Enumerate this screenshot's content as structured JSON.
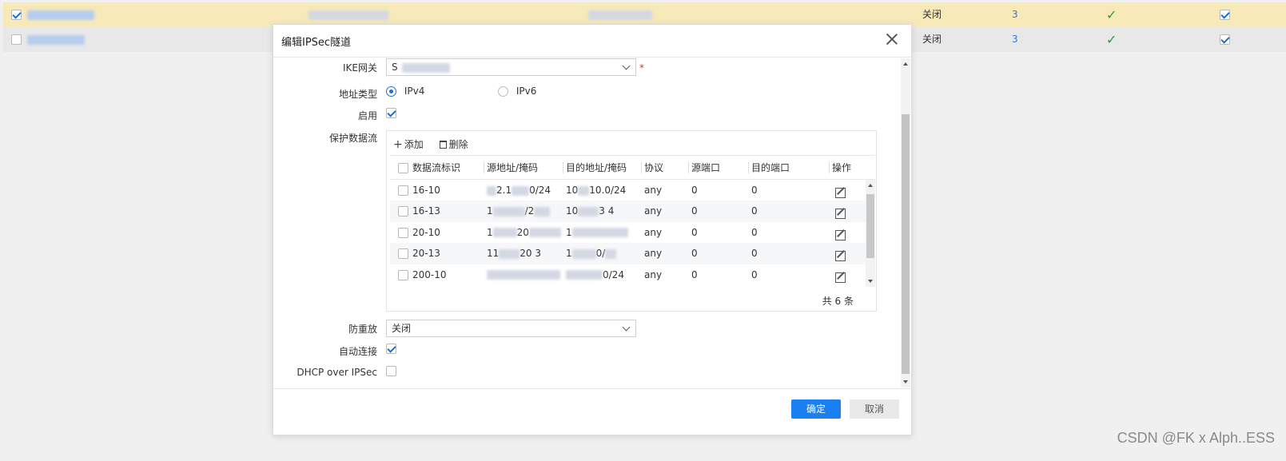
{
  "background_rows": [
    {
      "checked": true,
      "col1": "关闭",
      "col2": "3"
    },
    {
      "checked": false,
      "col1": "关闭",
      "col2": "3"
    }
  ],
  "dialog": {
    "title": "编辑IPSec隧道",
    "fields": {
      "ike_gateway_label": "IKE网关",
      "ike_gateway_value": "S",
      "required_mark": "*",
      "address_type_label": "地址类型",
      "ipv4_label": "IPv4",
      "ipv6_label": "IPv6",
      "enable_label": "启用",
      "protected_flow_label": "保护数据流",
      "anti_replay_label": "防重放",
      "anti_replay_value": "关闭",
      "auto_connect_label": "自动连接",
      "dhcp_label": "DHCP over IPSec"
    },
    "toolbar": {
      "add_label": "添加",
      "delete_label": "删除"
    },
    "grid": {
      "headers": [
        "数据流标识",
        "源地址/掩码",
        "目的地址/掩码",
        "协议",
        "源端口",
        "目的端口",
        "操作"
      ],
      "rows": [
        {
          "id": "16-10",
          "src": "2.1",
          "src_tail": "0/24",
          "dst": "10",
          "dst_tail": "10.0/24",
          "proto": "any",
          "sport": "0",
          "dport": "0"
        },
        {
          "id": "16-13",
          "src": "1",
          "src_tail": "/2",
          "dst": "10",
          "dst_tail": "3  4",
          "proto": "any",
          "sport": "0",
          "dport": "0"
        },
        {
          "id": "20-10",
          "src": "1",
          "src_tail": "20",
          "dst": "1",
          "dst_tail": "",
          "proto": "any",
          "sport": "0",
          "dport": "0"
        },
        {
          "id": "20-13",
          "src": "11",
          "src_tail": "20  3",
          "dst": "1",
          "dst_tail": "0/",
          "proto": "any",
          "sport": "0",
          "dport": "0"
        },
        {
          "id": "200-10",
          "src": "",
          "src_tail": "",
          "dst": "",
          "dst_tail": "0/24",
          "proto": "any",
          "sport": "0",
          "dport": "0"
        }
      ],
      "total": "共 6 条"
    },
    "buttons": {
      "ok": "确定",
      "cancel": "取消"
    }
  },
  "watermark": "CSDN @FK x Alph..ESS"
}
